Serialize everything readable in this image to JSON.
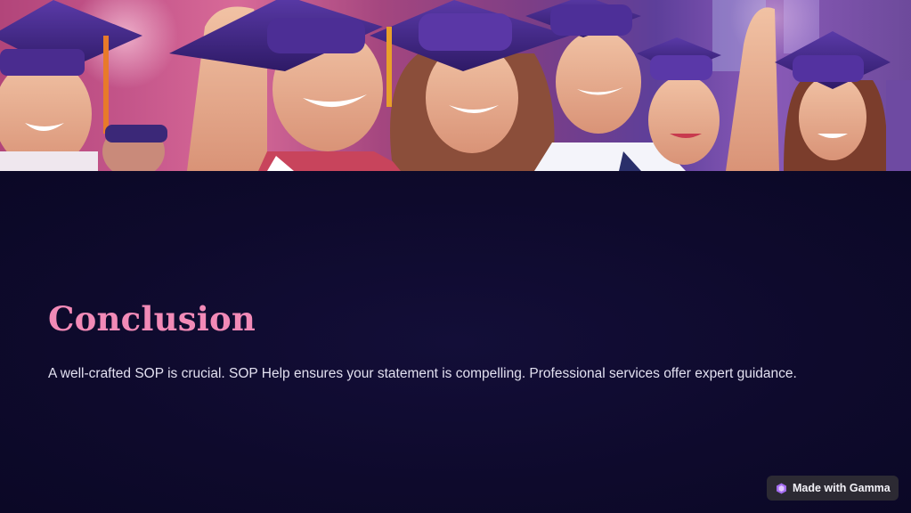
{
  "slide": {
    "title": "Conclusion",
    "body": "A well-crafted SOP is crucial. SOP Help ensures your statement is compelling. Professional services offer expert guidance."
  },
  "hero_image": {
    "icon": "graduates-photo"
  },
  "badge": {
    "label": "Made with Gamma",
    "icon": "gamma-logo-icon"
  },
  "colors": {
    "background": "#0e0a2c",
    "title": "#f28ab7",
    "body_text": "#e2e0f0",
    "badge_bg": "#2c2a33",
    "cap_purple": "#4b2c8f"
  }
}
